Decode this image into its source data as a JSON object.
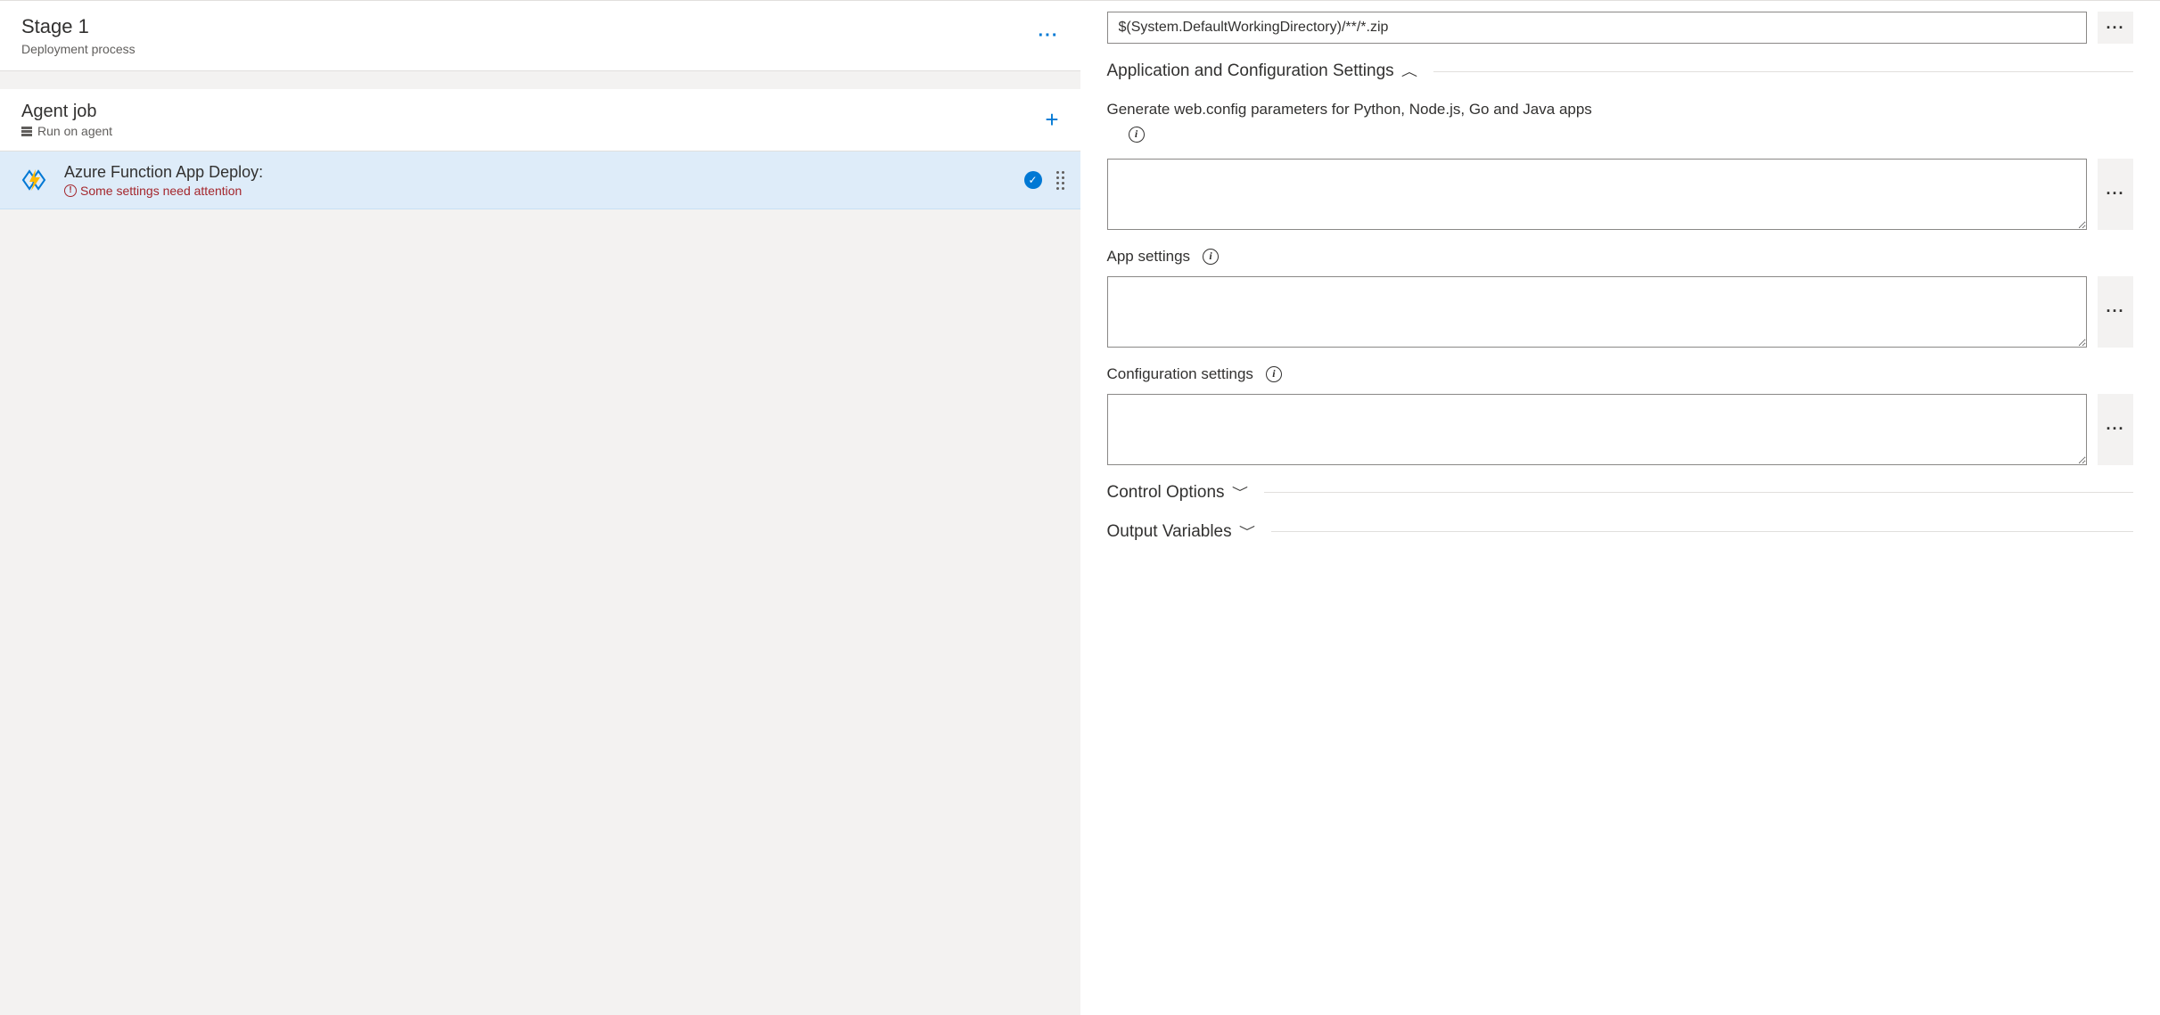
{
  "stage": {
    "title": "Stage 1",
    "subtitle": "Deployment process"
  },
  "agentJob": {
    "title": "Agent job",
    "subtitle": "Run on agent"
  },
  "task": {
    "title": "Azure Function App Deploy:",
    "warning": "Some settings need attention"
  },
  "form": {
    "packageValue": "$(System.DefaultWorkingDirectory)/**/*.zip",
    "sections": {
      "appConfig": {
        "title": "Application and Configuration Settings",
        "fields": {
          "webConfig": {
            "label": "Generate web.config parameters for Python, Node.js, Go and Java apps",
            "value": ""
          },
          "appSettings": {
            "label": "App settings",
            "value": ""
          },
          "configSettings": {
            "label": "Configuration settings",
            "value": ""
          }
        }
      },
      "controlOptions": {
        "title": "Control Options"
      },
      "outputVariables": {
        "title": "Output Variables"
      }
    }
  }
}
